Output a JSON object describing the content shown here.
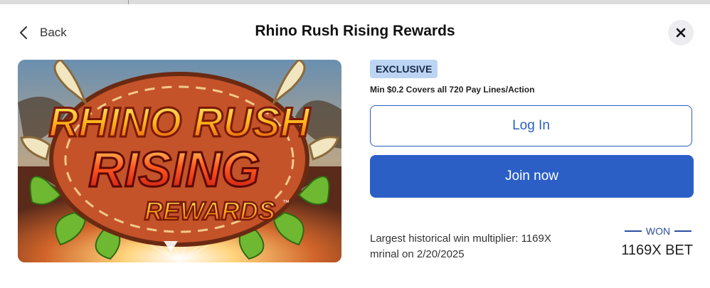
{
  "header": {
    "back_label": "Back",
    "title": "Rhino Rush Rising Rewards",
    "back_icon": "chevron-left-icon",
    "close_icon": "close-icon"
  },
  "hero": {
    "logo_line1": "RHINO RUSH",
    "logo_line2": "RISING",
    "logo_line3": "REWARDS",
    "trademark": "™"
  },
  "offer": {
    "badge": "EXCLUSIVE",
    "terms": "Min $0.2 Covers all 720 Pay Lines/Action"
  },
  "actions": {
    "login_label": "Log In",
    "join_label": "Join now"
  },
  "win": {
    "line1": "Largest historical win multiplier: 1169X",
    "line2": "mrinal on 2/20/2025",
    "won_label": "WON",
    "bet_value": "1169X BET"
  },
  "colors": {
    "accent": "#2b5fc6",
    "badge_bg": "#bcd5f5",
    "close_bg": "#ececf1"
  }
}
